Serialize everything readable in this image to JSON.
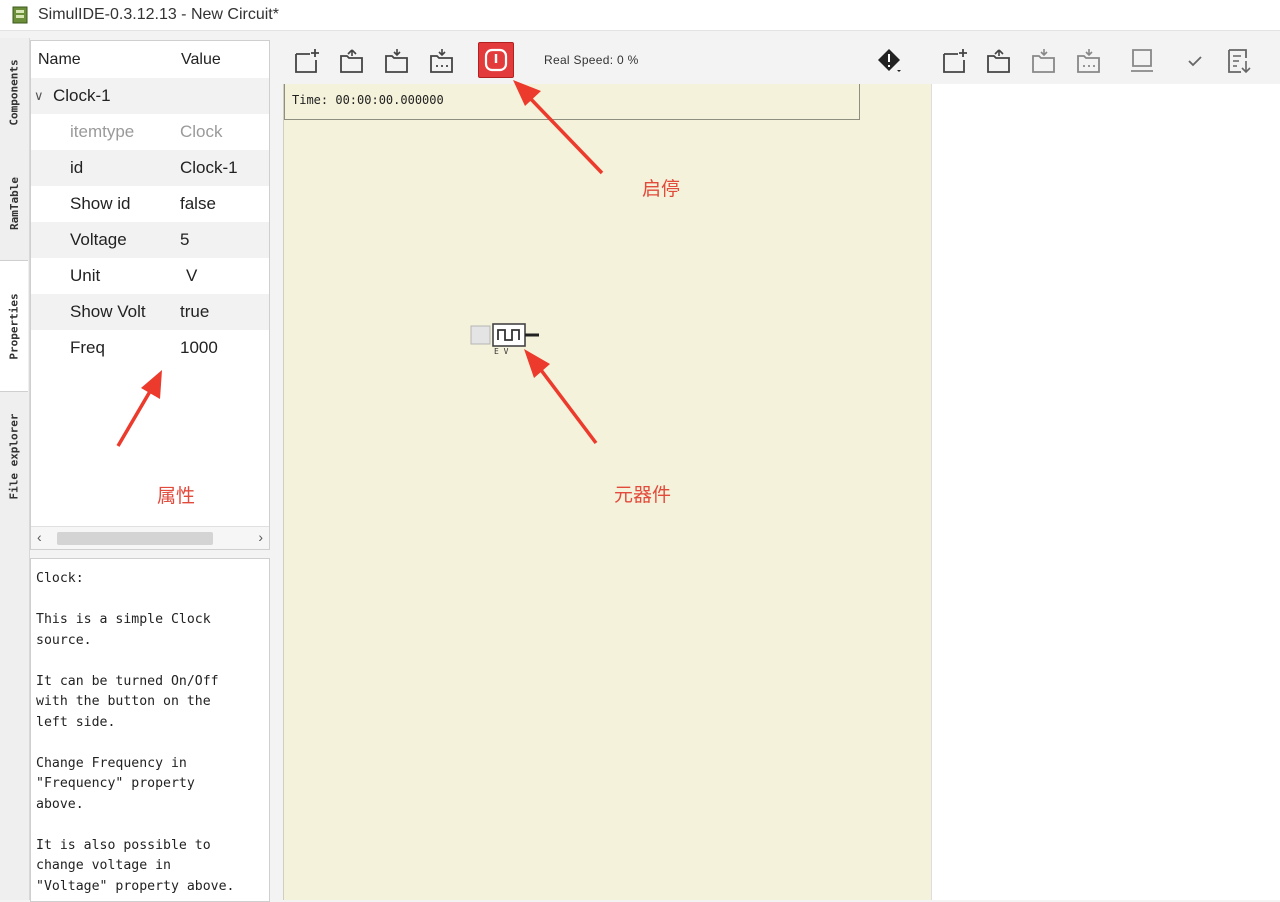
{
  "window": {
    "title": "SimulIDE-0.3.12.13  -  New Circuit*"
  },
  "side_tabs": [
    "Components",
    "RamTable",
    "Properties",
    "File explorer"
  ],
  "properties": {
    "header": {
      "name": "Name",
      "value": "Value"
    },
    "component": "Clock-1",
    "rows": [
      {
        "name": "itemtype",
        "value": "Clock"
      },
      {
        "name": "id",
        "value": "Clock-1"
      },
      {
        "name": "Show id",
        "value": "false"
      },
      {
        "name": "Voltage",
        "value": "5"
      },
      {
        "name": "Unit",
        "value": "V"
      },
      {
        "name": "Show Volt",
        "value": "true"
      },
      {
        "name": "Freq",
        "value": "1000"
      }
    ]
  },
  "help": {
    "text": "Clock:\n\nThis is a simple Clock\nsource.\n\nIt can be turned On/Off\nwith the button on the\nleft side.\n\nChange Frequency in\n\"Frequency\" property\nabove.\n\nIt is also possible to\nchange voltage in\n\"Voltage\" property above."
  },
  "toolbar": {
    "icons": [
      "new-circuit-icon",
      "open-circuit-icon",
      "save-circuit-icon",
      "save-as-icon"
    ],
    "power_label": "Start/Stop simulation",
    "speed": "Real Speed: 0 %",
    "right_icons": [
      "debug-icon",
      "new-file-icon",
      "open-file-icon",
      "save-file-icon",
      "save-file-as-icon",
      "find-icon",
      "compile-check-icon",
      "upload-icon"
    ]
  },
  "canvas": {
    "time": "Time:  00:00:00.000000",
    "component_label": "E V"
  },
  "annotations": {
    "start_stop": "启停",
    "properties": "属性",
    "component": "元器件"
  },
  "colors": {
    "canvas": "#f4f2da",
    "power_button": "#e33b3b",
    "annotation": "#e24a3b"
  }
}
